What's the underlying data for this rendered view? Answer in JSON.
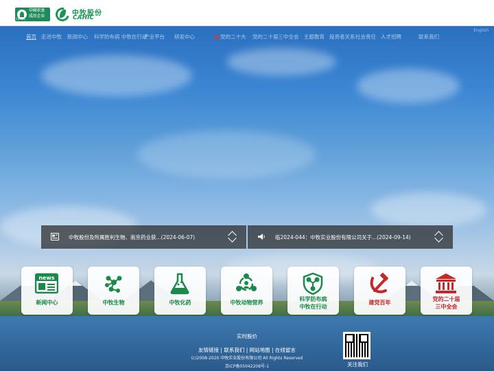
{
  "header": {
    "logo1_line1": "中国农发",
    "logo1_line2": "成员企业",
    "logo1_sub": "CNADC",
    "logo2_cn": "中牧股份",
    "logo2_en": "CAHIC"
  },
  "nav": {
    "items": [
      {
        "label": "首页"
      },
      {
        "label": "走进中牧"
      },
      {
        "label": "新闻中心"
      },
      {
        "label": "科学防布病 中牧在行动"
      },
      {
        "label": "产业平台"
      },
      {
        "label": "研发中心"
      },
      {
        "label": "党的二十大"
      },
      {
        "label": "党的二十届三中全会"
      },
      {
        "label": "主题教育"
      },
      {
        "label": "投资者关系"
      },
      {
        "label": "社会责任"
      },
      {
        "label": "人才招聘"
      },
      {
        "label": "联系我们"
      }
    ],
    "lang": "English"
  },
  "ticker": {
    "left_text": "中牧股份及所属胜利生物、南京药业获...(2024-06-07)",
    "right_text": "临2024-044：中牧实业股份有限公司关于...(2024-09-14)"
  },
  "tiles": [
    {
      "line1": "新闻中心",
      "line2": ""
    },
    {
      "line1": "中牧生物",
      "line2": ""
    },
    {
      "line1": "中牧化药",
      "line2": ""
    },
    {
      "line1": "中牧动物营养",
      "line2": ""
    },
    {
      "line1": "科学防布病",
      "line2": "中牧在行动"
    },
    {
      "line1": "建党百年",
      "line2": ""
    },
    {
      "line1": "党的二十届",
      "line2": "三中全会"
    }
  ],
  "footer": {
    "stock": "实时股价",
    "links": "友情链接 | 联系我们 | 网站地图 | 在线留言",
    "copyright": "(c)2008-2020 中牧实业股份有限公司 All Rights Reserved",
    "icp": "京ICP备05042208号-1",
    "qr_label": "关注我们"
  },
  "colors": {
    "brand_green": "#1a8a4a",
    "party_red": "#c62828"
  }
}
